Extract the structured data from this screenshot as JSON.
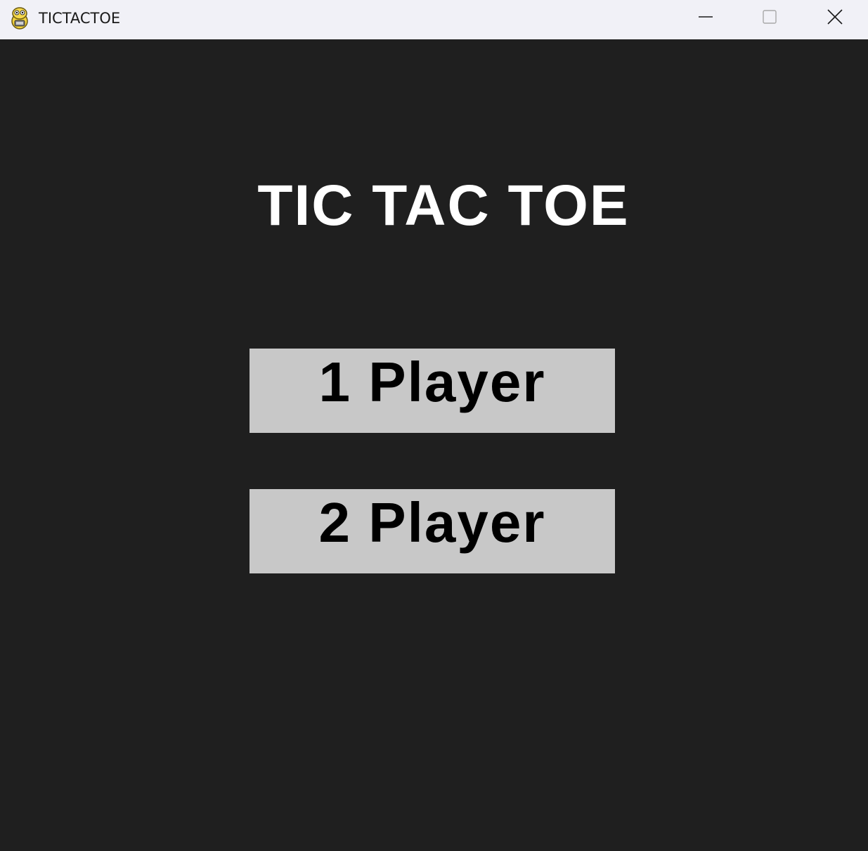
{
  "window": {
    "title": "TICTACTOE",
    "app_icon": "pygame-snake-icon",
    "controls": {
      "minimize": "minimize-icon",
      "maximize": "maximize-icon",
      "close": "close-icon"
    }
  },
  "game": {
    "title": "TIC TAC TOE",
    "buttons": [
      {
        "label": "1 Player"
      },
      {
        "label": "2 Player"
      }
    ]
  },
  "colors": {
    "background": "#1f1f1f",
    "titlebar": "#f1f1f7",
    "title_text": "#ffffff",
    "button_bg": "#c8c8c8",
    "button_text": "#000000"
  }
}
